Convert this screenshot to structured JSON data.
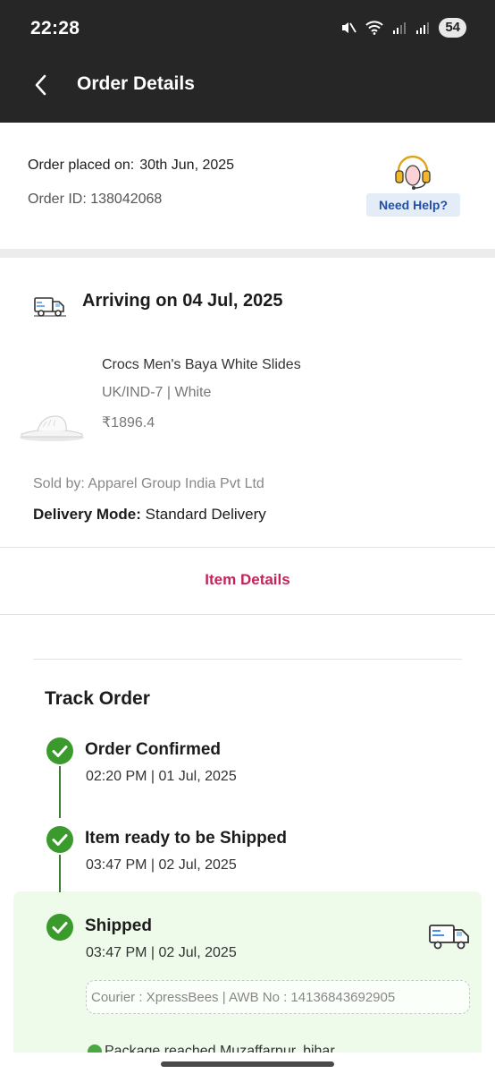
{
  "status_bar": {
    "time": "22:28",
    "battery": "54"
  },
  "header": {
    "title": "Order Details"
  },
  "order": {
    "placed_label": "Order placed on:",
    "placed_date": "30th Jun, 2025",
    "order_id": "Order ID: 138042068",
    "help_label": "Need Help?"
  },
  "shipment": {
    "arrival": "Arriving on 04 Jul, 2025",
    "product_name": "Crocs Men's Baya White Slides",
    "variant": "UK/IND-7 | White",
    "price": "₹1896.4",
    "sold_by": "Sold by: Apparel Group India Pvt Ltd",
    "delivery_mode_label": "Delivery Mode:",
    "delivery_mode_value": "Standard Delivery",
    "item_details_label": "Item Details"
  },
  "track": {
    "title": "Track Order",
    "steps": [
      {
        "title": "Order Confirmed",
        "time": "02:20 PM | 01 Jul, 2025"
      },
      {
        "title": "Item ready to be Shipped",
        "time": "03:47 PM | 02 Jul, 2025"
      },
      {
        "title": "Shipped",
        "time": "03:47 PM | 02 Jul, 2025"
      }
    ],
    "courier": "Courier : XpressBees | AWB No : 14136843692905",
    "latest_update": "Package reached Muzaffarpur, bihar"
  },
  "colors": {
    "header_bg": "#262626",
    "accent_pink": "#c2255c",
    "help_blue": "#1f4fa8",
    "check_green": "#3a9a2c",
    "shipped_bg": "#eefbea"
  },
  "icons": {
    "back": "chevron-left-icon",
    "help": "headset-icon",
    "arrival": "delivery-truck-icon",
    "check": "check-circle-icon"
  }
}
